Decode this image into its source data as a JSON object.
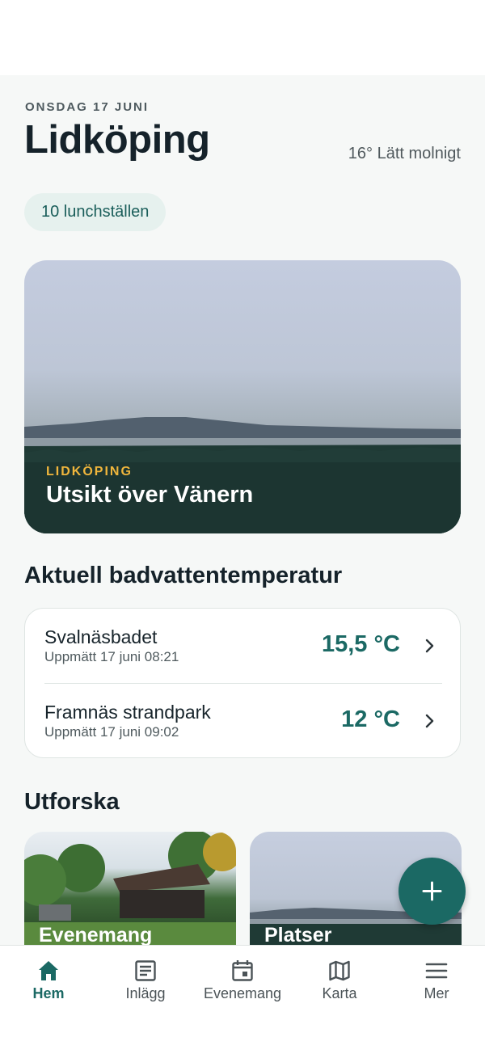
{
  "header": {
    "date": "ONSDAG 17 JUNI",
    "city": "Lidköping",
    "weather": "16° Lätt molnigt"
  },
  "lunch_chip": {
    "label": "10 lunchställen"
  },
  "hero": {
    "eyebrow": "LIDKÖPING",
    "title": "Utsikt över Vänern"
  },
  "bath_temps": {
    "title": "Aktuell badvattentemperatur",
    "items": [
      {
        "name": "Svalnäsbadet",
        "measured": "Uppmätt 17 juni 08:21",
        "value": "15,5 °C"
      },
      {
        "name": "Framnäs strandpark",
        "measured": "Uppmätt 17 juni 09:02",
        "value": "12 °C"
      }
    ]
  },
  "explore": {
    "title": "Utforska",
    "cards": [
      {
        "label": "Evenemang"
      },
      {
        "label": "Platser"
      }
    ]
  },
  "fab": {
    "icon": "plus-icon"
  },
  "tabbar": {
    "tabs": [
      {
        "label": "Hem",
        "icon": "home-icon",
        "active": true
      },
      {
        "label": "Inlägg",
        "icon": "article-icon",
        "active": false
      },
      {
        "label": "Evenemang",
        "icon": "calendar-icon",
        "active": false
      },
      {
        "label": "Karta",
        "icon": "map-icon",
        "active": false
      },
      {
        "label": "Mer",
        "icon": "menu-icon",
        "active": false
      }
    ]
  },
  "colors": {
    "accent": "#1b6964",
    "eyebrow": "#f0b63c",
    "chip_bg": "#e6f1ee",
    "background": "#f6f8f7"
  }
}
